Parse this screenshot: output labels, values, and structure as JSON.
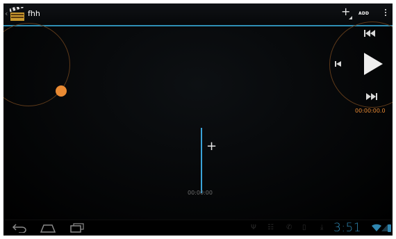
{
  "app": {
    "title": "fhh"
  },
  "action_bar": {
    "add_label": "ADD"
  },
  "transport": {
    "current_time": "00:00:00.0"
  },
  "timeline": {
    "time_label": "00:00:00"
  },
  "status_bar": {
    "clock": "3:51"
  },
  "icons": {
    "back": "chevron-left",
    "app": "clapperboard",
    "add": "plus",
    "overflow": "vertical-dots",
    "rewind": "rewind",
    "step_back": "step-back",
    "play": "play",
    "fast_forward": "fast-forward",
    "add_clip": "plus",
    "nav_back": "back-arrow",
    "nav_home": "home",
    "nav_recents": "recent-apps",
    "usb": "usb",
    "debug": "android-debug",
    "call": "phone",
    "sd": "sd-card",
    "download": "download",
    "wifi": "wifi",
    "signal": "cell-signal",
    "battery": "battery"
  },
  "colors": {
    "accent": "#2f8fb5",
    "orange": "#e98a33",
    "background": "#000000"
  }
}
